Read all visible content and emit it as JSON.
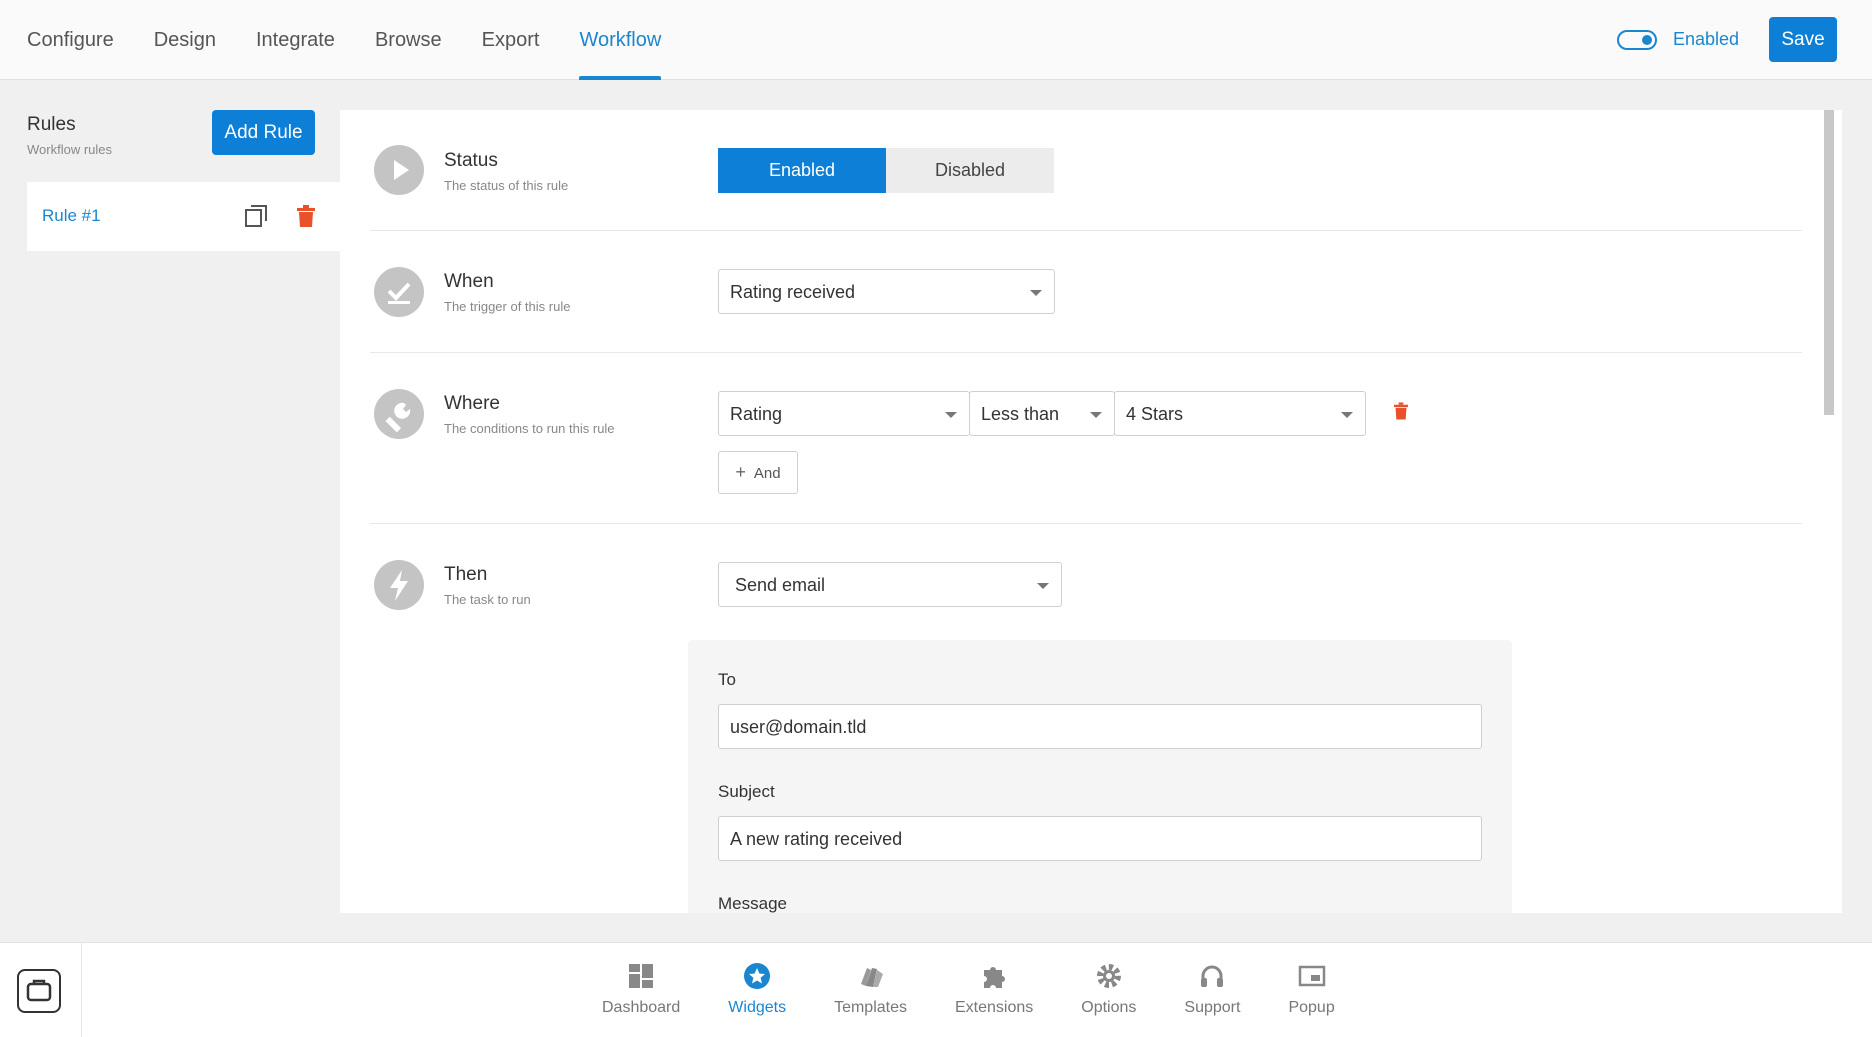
{
  "top_nav": {
    "tabs": [
      {
        "label": "Configure"
      },
      {
        "label": "Design"
      },
      {
        "label": "Integrate"
      },
      {
        "label": "Browse"
      },
      {
        "label": "Export"
      },
      {
        "label": "Workflow",
        "active": true
      }
    ],
    "toggle_label": "Enabled",
    "save_label": "Save",
    "accent_color": "#1a86d0"
  },
  "sidebar": {
    "title": "Rules",
    "subtitle": "Workflow rules",
    "add_rule_label": "Add Rule",
    "rules": [
      {
        "name": "Rule #1"
      }
    ]
  },
  "rule": {
    "status": {
      "title": "Status",
      "subtitle": "The status of this rule",
      "options": [
        "Enabled",
        "Disabled"
      ],
      "selected": "Enabled"
    },
    "when": {
      "title": "When",
      "subtitle": "The trigger of this rule",
      "trigger": "Rating received"
    },
    "where": {
      "title": "Where",
      "subtitle": "The conditions to run this rule",
      "field": "Rating",
      "operator": "Less than",
      "value": "4 Stars",
      "and_label": "And"
    },
    "then": {
      "title": "Then",
      "subtitle": "The task to run",
      "task": "Send email",
      "to_label": "To",
      "to_value": "user@domain.tld",
      "subject_label": "Subject",
      "subject_value": "A new rating received",
      "message_label": "Message"
    }
  },
  "bottom_nav": {
    "items": [
      {
        "label": "Dashboard",
        "icon": "dashboard-icon"
      },
      {
        "label": "Widgets",
        "icon": "star-icon",
        "active": true
      },
      {
        "label": "Templates",
        "icon": "templates-icon"
      },
      {
        "label": "Extensions",
        "icon": "puzzle-icon"
      },
      {
        "label": "Options",
        "icon": "gear-icon"
      },
      {
        "label": "Support",
        "icon": "headphones-icon"
      },
      {
        "label": "Popup",
        "icon": "popup-icon"
      }
    ]
  }
}
